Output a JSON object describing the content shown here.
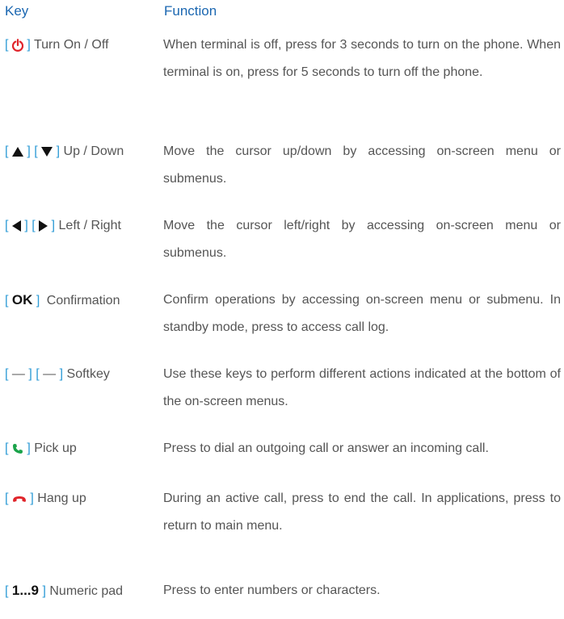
{
  "header": {
    "key": "Key",
    "function": "Function"
  },
  "colors": {
    "header_blue": "#1b67b1",
    "bracket_blue": "#2e9bd6",
    "power_red": "#e0242a",
    "pickup_green": "#1aa34a",
    "hangup_red": "#e0242a",
    "text_gray": "#555555"
  },
  "rows": [
    {
      "icon": "power-icon",
      "key_label": "Turn On / Off",
      "description": "When terminal is off, press for 3 seconds to turn on the phone. When terminal is on, press for 5 seconds to turn off the phone."
    },
    {
      "icon": "up-down-triangles-icon",
      "key_label": "Up / Down",
      "description": "Move the cursor up/down by accessing on-screen menu or submenus."
    },
    {
      "icon": "left-right-triangles-icon",
      "key_label": "Left / Right",
      "description": "Move the cursor left/right by accessing on-screen menu or submenus."
    },
    {
      "symbol_text": "OK",
      "key_label": "Confirmation",
      "description": "Confirm operations by accessing on-screen menu or submenu. In standby mode, press to access call log."
    },
    {
      "symbol_text": "—",
      "key_label": "Softkey",
      "description": "Use these keys to perform different actions indicated at the bottom of the on-screen menus."
    },
    {
      "icon": "phone-pickup-icon",
      "key_label": "Pick up",
      "description": "Press to dial an outgoing call or answer an incoming call."
    },
    {
      "icon": "phone-hangup-icon",
      "key_label": "Hang up",
      "description": "During an active call, press to end the call. In applications, press to return to main menu."
    },
    {
      "symbol_text": "1...9",
      "key_label": "Numeric pad",
      "description": "Press to enter numbers or characters."
    }
  ]
}
